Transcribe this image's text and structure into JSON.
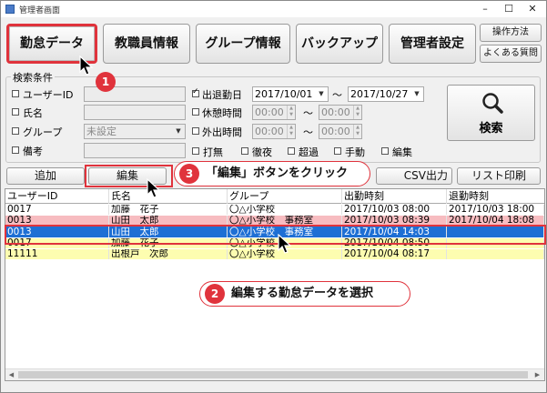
{
  "window": {
    "title": "管理者画面",
    "minimize": "–",
    "maximize": "☐",
    "close": "✕"
  },
  "nav": {
    "attendance": "勤怠データ",
    "staff": "教職員情報",
    "group": "グループ情報",
    "backup": "バックアップ",
    "admin": "管理者設定",
    "manual": "操作方法",
    "faq": "よくある質問"
  },
  "search": {
    "legend": "検索条件",
    "user_id_label": "ユーザーID",
    "name_label": "氏名",
    "group_label": "グループ",
    "group_value": "未設定",
    "note_label": "備考",
    "attend_date_label": "出退勤日",
    "attend_from": "2017/10/01",
    "attend_to": "2017/10/27",
    "range_sep": "～",
    "rest_label": "休憩時間",
    "out_label": "外出時間",
    "time_placeholder": "00:00",
    "flag_dakumu": "打無",
    "flag_tetsuya": "徹夜",
    "flag_choka": "超過",
    "flag_shudo": "手動",
    "flag_henshu": "編集",
    "search_button": "検索"
  },
  "actions": {
    "add": "追加",
    "edit": "編集",
    "csv": "CSV出力",
    "print": "リスト印刷"
  },
  "grid": {
    "headers": [
      "ユーザーID",
      "氏名",
      "グループ",
      "出勤時刻",
      "退勤時刻"
    ],
    "rows": [
      {
        "id": "0017",
        "name": "加藤　花子",
        "group": "〇△小学校",
        "in": "2017/10/03 08:00",
        "out": "2017/10/03 18:00",
        "style": "normal"
      },
      {
        "id": "0013",
        "name": "山田　太郎",
        "group": "〇△小学校　事務室",
        "in": "2017/10/03 08:39",
        "out": "2017/10/04 18:08",
        "style": "pink"
      },
      {
        "id": "0013",
        "name": "山田　太郎",
        "group": "〇△小学校　事務室",
        "in": "2017/10/04 14:03",
        "out": "",
        "style": "selected"
      },
      {
        "id": "0017",
        "name": "加藤　花子",
        "group": "〇△小学校",
        "in": "2017/10/04 08:50",
        "out": "",
        "style": "yellow"
      },
      {
        "id": "11111",
        "name": "出根戸　次郎",
        "group": "〇△小学校",
        "in": "2017/10/04 08:17",
        "out": "",
        "style": "yellow"
      }
    ]
  },
  "annotations": {
    "step1_badge": "1",
    "step2_badge": "2",
    "step2_text": "編集する勤怠データを選択",
    "step3_badge": "3",
    "step3_text": "「編集」ボタンをクリック"
  },
  "colors": {
    "accent_red": "#e0333c",
    "row_pink": "#f7bcc0",
    "row_selected": "#1e6fd4",
    "row_yellow": "#fdfdb0"
  }
}
